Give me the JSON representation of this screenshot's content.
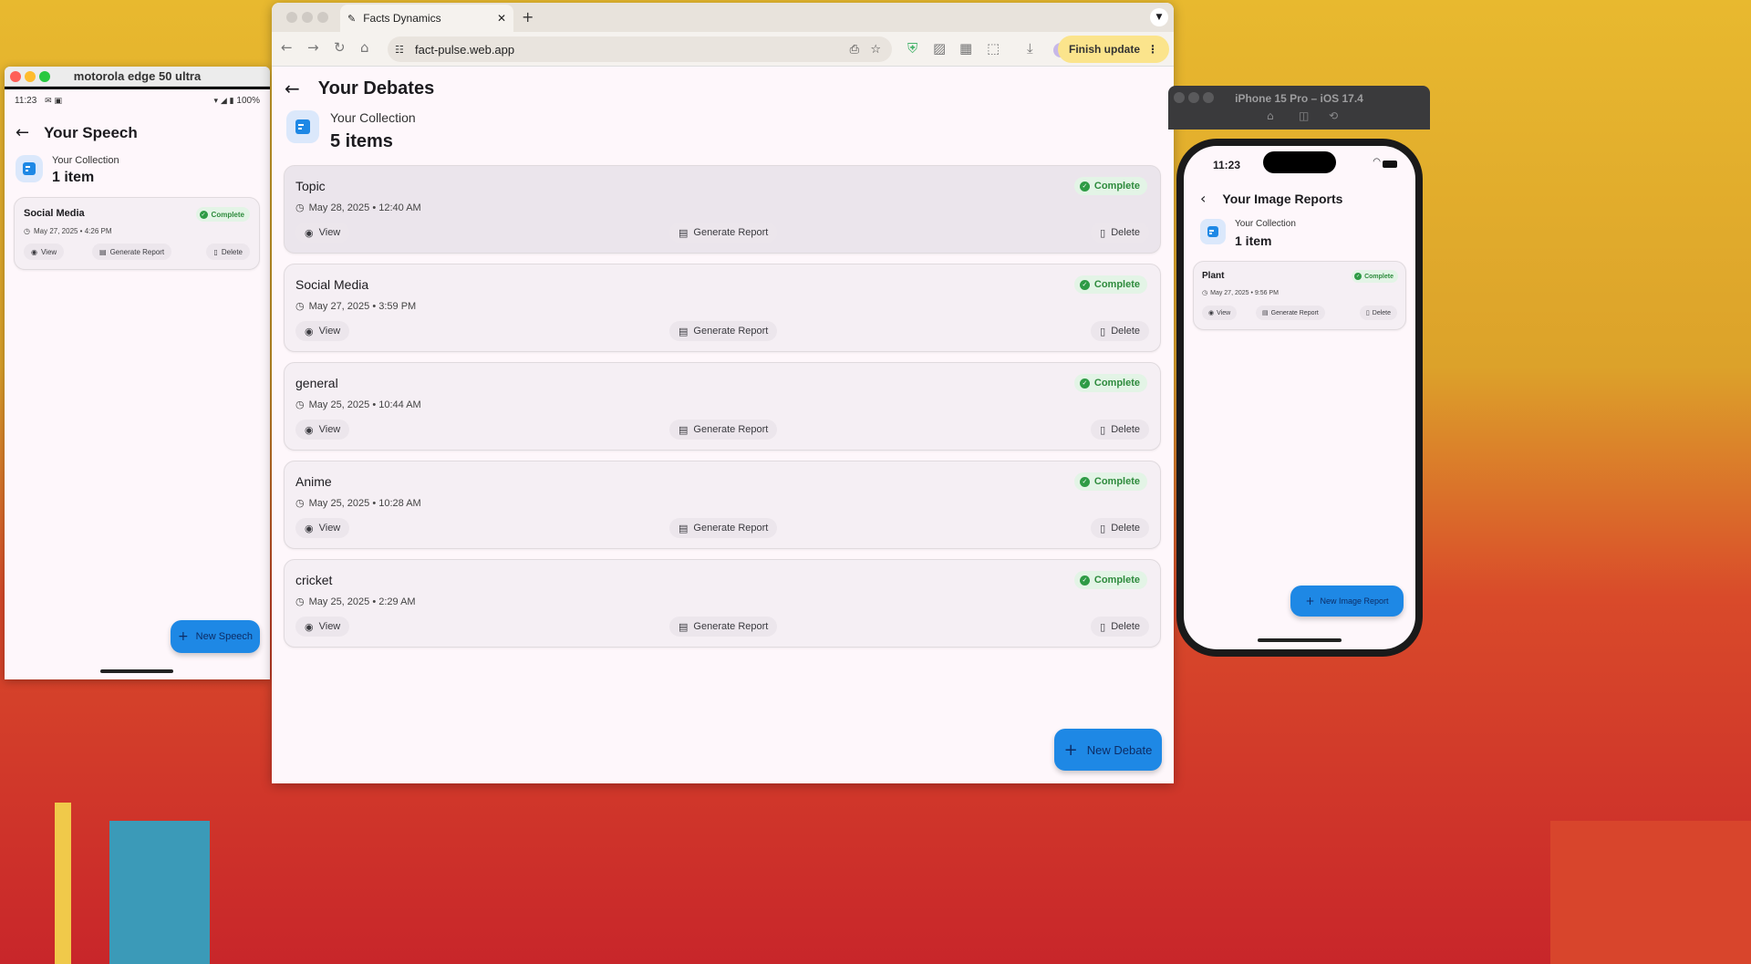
{
  "android": {
    "window_title": "motorola edge 50 ultra",
    "status_time": "11:23",
    "status_battery": "100%",
    "page_title": "Your Speech",
    "collection_label": "Your Collection",
    "collection_count": "1 item",
    "items": [
      {
        "title": "Social Media",
        "date": "May 27, 2025 • 4:26 PM",
        "status": "Complete"
      }
    ],
    "view_label": "View",
    "report_label": "Generate Report",
    "delete_label": "Delete",
    "fab_label": "New Speech"
  },
  "browser": {
    "tab_title": "Facts Dynamics",
    "url": "fact-pulse.web.app",
    "finish_update": "Finish update",
    "page_title": "Your Debates",
    "collection_label": "Your Collection",
    "collection_count": "5 items",
    "items": [
      {
        "title": "Topic",
        "date": "May 28, 2025 • 12:40 AM",
        "status": "Complete"
      },
      {
        "title": "Social Media",
        "date": "May 27, 2025 • 3:59 PM",
        "status": "Complete"
      },
      {
        "title": "general",
        "date": "May 25, 2025 • 10:44 AM",
        "status": "Complete"
      },
      {
        "title": "Anime",
        "date": "May 25, 2025 • 10:28 AM",
        "status": "Complete"
      },
      {
        "title": "cricket",
        "date": "May 25, 2025 • 2:29 AM",
        "status": "Complete"
      }
    ],
    "view_label": "View",
    "report_label": "Generate Report",
    "delete_label": "Delete",
    "fab_label": "New Debate"
  },
  "iphone": {
    "window_title": "iPhone 15 Pro – iOS 17.4",
    "status_time": "11:23",
    "page_title": "Your Image Reports",
    "collection_label": "Your Collection",
    "collection_count": "1 item",
    "items": [
      {
        "title": "Plant",
        "date": "May 27, 2025 • 9:56 PM",
        "status": "Complete"
      }
    ],
    "view_label": "View",
    "report_label": "Generate Report",
    "delete_label": "Delete",
    "fab_label": "New Image Report"
  },
  "colors": {
    "accent": "#1e88e5",
    "complete_green": "#2e8b3d",
    "surface": "#fef7fb"
  }
}
